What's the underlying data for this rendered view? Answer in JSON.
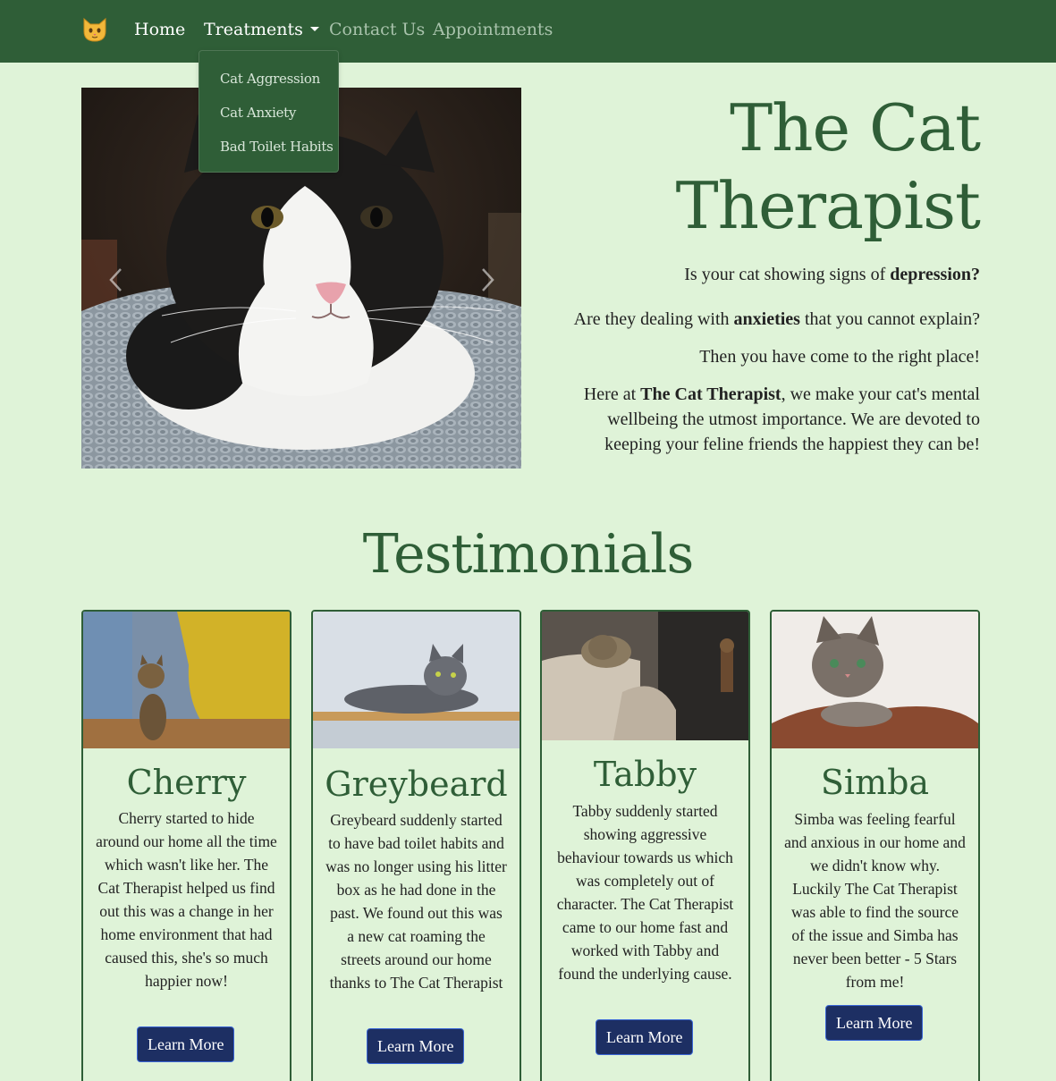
{
  "nav": {
    "brand_icon": "cat-face-icon",
    "items": [
      {
        "label": "Home"
      },
      {
        "label": "Treatments"
      },
      {
        "label": "Contact Us"
      },
      {
        "label": "Appointments"
      }
    ],
    "dropdown": [
      {
        "label": "Cat Aggression"
      },
      {
        "label": "Cat Anxiety"
      },
      {
        "label": "Bad Toilet Habits"
      }
    ]
  },
  "hero": {
    "title_line1": "The Cat",
    "title_line2": "Therapist",
    "p1_pre": "Is your cat showing signs of ",
    "p1_bold": "depression?",
    "p2_pre": "Are they dealing with ",
    "p2_bold": "anxieties",
    "p2_post": " that you cannot explain?",
    "p3": "Then you have come to the right place!",
    "p4_pre": "Here at ",
    "p4_bold": "The Cat Therapist",
    "p4_post": ", we make your cat's mental wellbeing the utmost importance. We are devoted to keeping your feline friends the happiest they can be!"
  },
  "testimonials": {
    "title": "Testimonials",
    "cards": [
      {
        "name": "Cherry",
        "text": "Cherry started to hide around our home all the time which wasn't like her. The Cat Therapist helped us find out this was a change in her home environment that had caused this, she's so much happier now!",
        "button": "Learn More"
      },
      {
        "name": "Greybeard",
        "text": "Greybeard suddenly started to have bad toilet habits and was no longer using his litter box as he had done in the past. We found out this was a new cat roaming the streets around our home thanks to The Cat Therapist",
        "button": "Learn More"
      },
      {
        "name": "Tabby",
        "text": "Tabby suddenly started showing aggressive behaviour towards us which was completely out of character. The Cat Therapist came to our home fast and worked with Tabby and found the underlying cause.",
        "button": "Learn More"
      },
      {
        "name": "Simba",
        "text": "Simba was feeling fearful and anxious in our home and we didn't know why. Luckily The Cat Therapist was able to find the source of the issue and Simba has never been better - 5 Stars from me!",
        "button": "Learn More"
      }
    ]
  },
  "colors": {
    "background": "#dff3d8",
    "navbar": "#2f5e37",
    "accent_green": "#2f5e37",
    "button": "#1d2f63"
  }
}
